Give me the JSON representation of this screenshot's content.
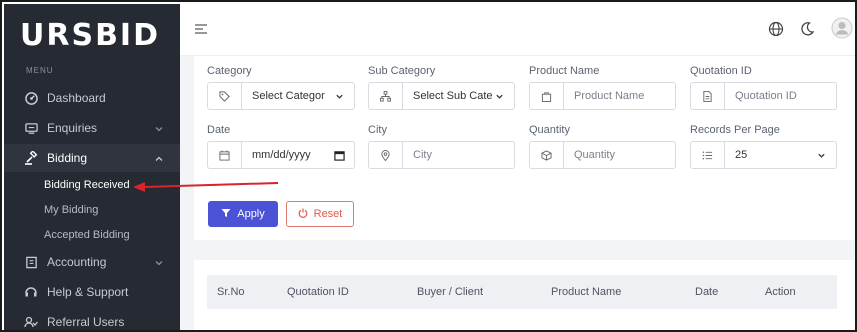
{
  "sidebar": {
    "logo": "URSBID",
    "menu_title": "MENU",
    "items": [
      {
        "label": "Dashboard",
        "icon": "dashboard-icon"
      },
      {
        "label": "Enquiries",
        "icon": "enquiries-icon"
      },
      {
        "label": "Bidding",
        "icon": "bidding-icon"
      },
      {
        "label": "Accounting",
        "icon": "accounting-icon"
      },
      {
        "label": "Help & Support",
        "icon": "support-icon"
      },
      {
        "label": "Referral Users",
        "icon": "users-icon"
      }
    ],
    "bidding_sub": [
      {
        "label": "Bidding Received"
      },
      {
        "label": "My Bidding"
      },
      {
        "label": "Accepted Bidding"
      }
    ]
  },
  "header": {
    "menu_icon": "hamburger-icon",
    "icons": [
      "globe-icon",
      "moon-icon",
      "avatar-icon"
    ]
  },
  "filters": {
    "category": {
      "label": "Category",
      "placeholder": "Select Categor"
    },
    "sub_category": {
      "label": "Sub Category",
      "placeholder": "Select Sub Cate"
    },
    "product_name": {
      "label": "Product Name",
      "placeholder": "Product Name"
    },
    "quotation_id": {
      "label": "Quotation ID",
      "placeholder": "Quotation ID"
    },
    "date": {
      "label": "Date",
      "placeholder": "mm/dd/yyyy"
    },
    "city": {
      "label": "City",
      "placeholder": "City"
    },
    "quantity": {
      "label": "Quantity",
      "placeholder": "Quantity"
    },
    "records_per_page": {
      "label": "Records Per Page",
      "value": "25"
    }
  },
  "buttons": {
    "apply": "Apply",
    "reset": "Reset"
  },
  "table": {
    "columns": [
      "Sr.No",
      "Quotation ID",
      "Buyer / Client",
      "Product Name",
      "Date",
      "Action"
    ]
  },
  "colors": {
    "sidebar_bg": "#262a33",
    "primary": "#4b52d6",
    "reset": "#e05a47",
    "annotation_arrow": "#d9242b"
  }
}
